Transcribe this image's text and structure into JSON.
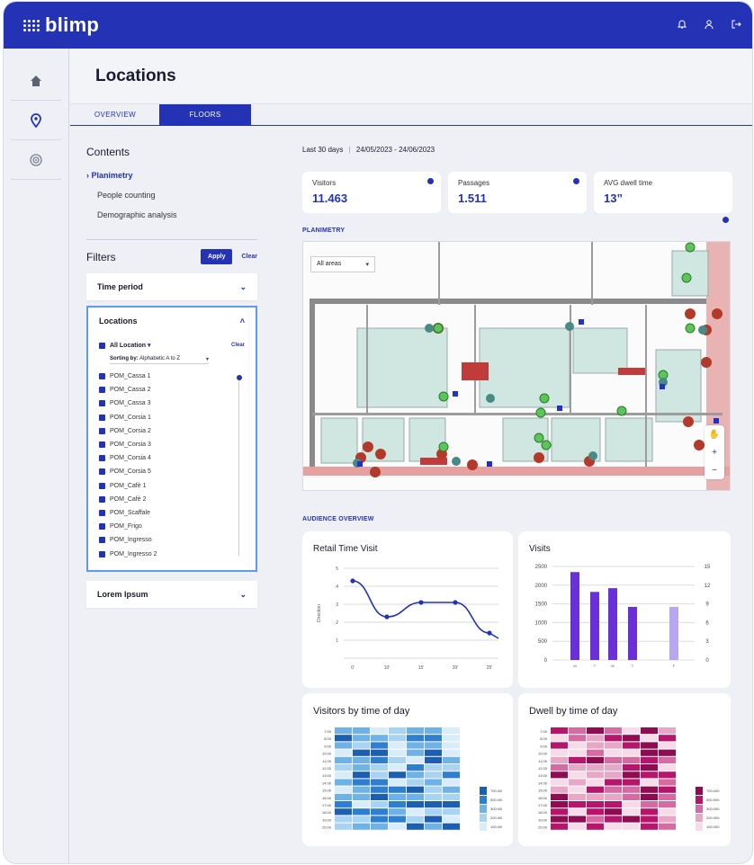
{
  "app": {
    "name": "blimp"
  },
  "header": {
    "title": "Locations"
  },
  "tabs": [
    {
      "label": "OVERVIEW"
    },
    {
      "label": "FLOORS"
    }
  ],
  "contents": {
    "title": "Contents",
    "items": [
      {
        "label": "Planimetry",
        "active": true
      },
      {
        "label": "People counting"
      },
      {
        "label": "Demographic analysis"
      }
    ]
  },
  "filters": {
    "title": "Filters",
    "apply": "Apply",
    "clear": "Clear",
    "time_period": "Time period",
    "locations": {
      "title": "Locations",
      "all_label": "All Location",
      "clear": "Clear",
      "sort_label": "Sorting by:",
      "sort_value": "Alphabetic A to Z",
      "items": [
        "POM_Cassa 1",
        "POM_Cassa 2",
        "POM_Cassa 3",
        "POM_Corsia 1",
        "POM_Corsia 2",
        "POM_Corsia 3",
        "POM_Corsia 4",
        "POM_Corsia 5",
        "POM_Cafè 1",
        "POM_Cafè 2",
        "POM_Scaffale",
        "POM_Frigo",
        "POM_Ingresso",
        "POM_Ingresso 2"
      ]
    },
    "lorem": "Lorem Ipsum"
  },
  "date": {
    "range_label": "Last 30 days",
    "separator": "|",
    "range": "24/05/2023 - 24/06/2023"
  },
  "kpis": [
    {
      "label": "Visitors",
      "value": "11.463"
    },
    {
      "label": "Passages",
      "value": "1.511"
    },
    {
      "label": "AVG dwell time",
      "value": "13”"
    }
  ],
  "planimetry": {
    "title": "PLANIMETRY",
    "area_select": "All areas"
  },
  "audience": {
    "title": "AUDIENCE OVERVIEW"
  },
  "colors": {
    "brand": "#2433b5",
    "accent_purple": "#6a2fd6",
    "heat_blue": "#2f7fd0",
    "heat_pink": "#b5166b"
  },
  "chart_data": [
    {
      "type": "line",
      "title": "Retail Time Visit",
      "ylabel": "Direction",
      "x": [
        "0'",
        "10'",
        "15'",
        "20'",
        "25'"
      ],
      "y": [
        4.3,
        2.3,
        3.1,
        3.1,
        1.4
      ],
      "yticks": [
        1,
        2,
        3,
        4,
        5
      ],
      "ylim": [
        0,
        5
      ]
    },
    {
      "type": "bar",
      "title": "Visits",
      "categories": [
        "M",
        "T",
        "W",
        "T",
        "F"
      ],
      "values": [
        2350,
        1820,
        1920,
        1420,
        1420
      ],
      "left_ticks": [
        "2500",
        "2000",
        "1500",
        "1000",
        "500",
        "0"
      ],
      "right_ticks": [
        "15",
        "12",
        "9",
        "6",
        "3",
        "0"
      ],
      "ylim": [
        0,
        2500
      ]
    },
    {
      "type": "heatmap",
      "title": "Visitors by time of day",
      "rows": [
        "7:00",
        "8:00",
        "9:00",
        "10:00",
        "11:00",
        "12:00",
        "13:00",
        "14:00",
        "15:00",
        "16:00",
        "17:00",
        "18:00",
        "19:00",
        "20:00"
      ],
      "legend": [
        "700.000",
        "500.000",
        "300.000",
        "200.000",
        "100.000"
      ]
    },
    {
      "type": "heatmap",
      "title": "Dwell by time of day",
      "rows": [
        "7:00",
        "8:00",
        "9:00",
        "10:00",
        "11:00",
        "12:00",
        "13:00",
        "14:00",
        "15:00",
        "16:00",
        "17:00",
        "18:00",
        "19:00",
        "20:00"
      ],
      "legend": [
        "700.000",
        "500.000",
        "300.000",
        "200.000",
        "100.000"
      ]
    }
  ]
}
